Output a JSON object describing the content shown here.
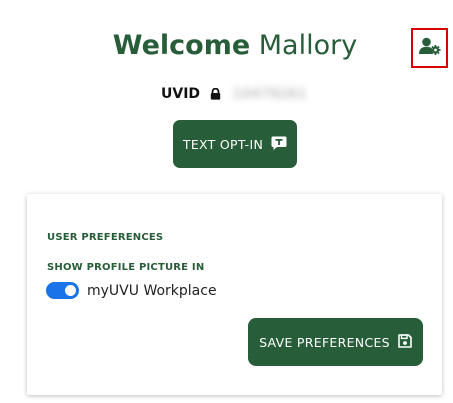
{
  "header": {
    "greeting": "Welcome",
    "user_name": "Mallory",
    "settings_icon": "user-gear-icon"
  },
  "uvid": {
    "label": "UVID",
    "lock_icon": "lock-icon",
    "value": "10479261"
  },
  "text_optin": {
    "label": "TEXT OPT-IN",
    "icon": "message-t-icon"
  },
  "preferences": {
    "title": "USER PREFERENCES",
    "profile_picture_label": "SHOW PROFILE PICTURE IN",
    "toggle_label": "myUVU Workplace",
    "toggle_on": true,
    "save_label": "SAVE PREFERENCES",
    "save_icon": "floppy-disk-icon"
  },
  "colors": {
    "brand_green": "#275d38",
    "toggle_blue": "#1a73e8",
    "highlight_red": "#d90000"
  }
}
